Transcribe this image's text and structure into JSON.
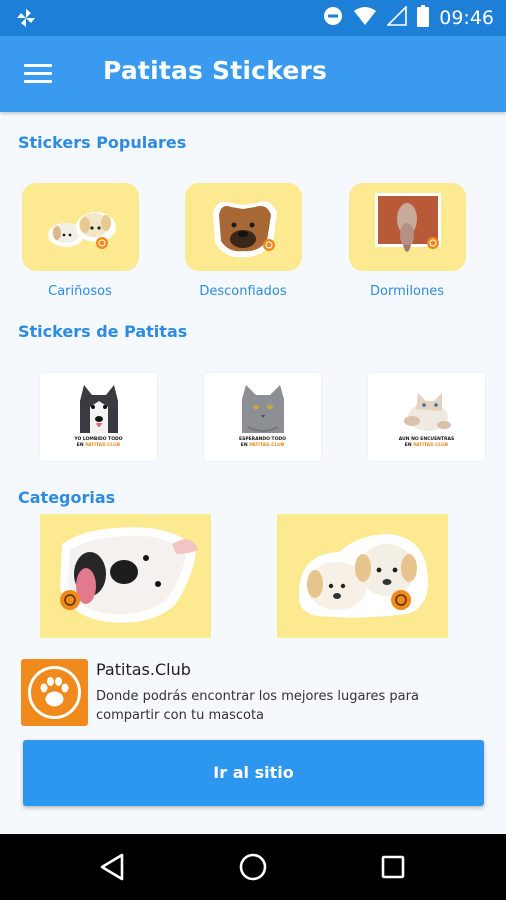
{
  "status_bar": {
    "time": "09:46",
    "icons": [
      "pinwheel-icon",
      "do-not-disturb-icon",
      "wifi-icon",
      "signal-icon",
      "battery-icon"
    ]
  },
  "app_bar": {
    "title": "Patitas Stickers",
    "menu_icon": "hamburger-menu-icon"
  },
  "sections": {
    "popular_title": "Stickers Populares",
    "patitas_title": "Stickers de Patitas",
    "categories_title": "Categorias"
  },
  "popular": [
    {
      "label": "Cariñosos",
      "image": "two-puppies-sticker"
    },
    {
      "label": "Desconfiados",
      "image": "boxer-dog-sticker"
    },
    {
      "label": "Dormilones",
      "image": "sleeping-dog-sticker"
    }
  ],
  "patitas_stickers": [
    {
      "caption_1": "YO LOMBIDO TODO",
      "caption_2_a": "EN ",
      "caption_2_b": "PATITAS.CLUB",
      "image": "husky-sticker"
    },
    {
      "caption_1": "ESPERANDO TODO",
      "caption_2_a": "EN ",
      "caption_2_b": "PATITAS.CLUB",
      "image": "gray-cat-sticker"
    },
    {
      "caption_1": "AUN NO ENCUENTRAS",
      "caption_2_a": "EN ",
      "caption_2_b": "PATITAS.CLUB",
      "image": "kitten-sticker"
    }
  ],
  "categories": [
    {
      "image": "white-dog-tongue-sticker"
    },
    {
      "image": "golden-puppies-sticker"
    }
  ],
  "promo": {
    "title": "Patitas.Club",
    "description": "Donde podrás encontrar los mejores lugares para compartir con tu mascota",
    "logo_icon": "paw-logo-icon"
  },
  "cta": {
    "label": "Ir al sitio"
  },
  "nav": {
    "icons": [
      "back-icon",
      "home-icon",
      "recents-icon"
    ]
  },
  "colors": {
    "status_bar": "#1e7fd6",
    "app_bar": "#3a9af0",
    "accent_text": "#2d8be4",
    "card_yellow": "#fde98f",
    "brand_orange": "#f08a1c",
    "button": "#2d96ef"
  }
}
